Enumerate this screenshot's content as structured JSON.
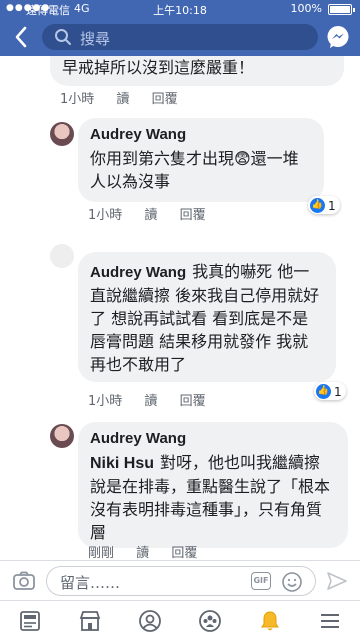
{
  "status_bar": {
    "carrier": "遠傳電信",
    "network": "4G",
    "time": "上午10:18",
    "battery_percent": "100%"
  },
  "nav": {
    "search_placeholder": "搜尋",
    "back_icon": "chevron-left-icon",
    "messenger_icon": "messenger-icon",
    "accent_color": "#4267b2"
  },
  "comments": [
    {
      "text": "早戒掉所以沒到這麼嚴重！",
      "time": "1小時",
      "read_label": "讀",
      "reply_label": "回覆"
    },
    {
      "author": "Audrey Wang",
      "text": "你用到第六隻才出現😨還一堆人以為沒事",
      "time": "1小時",
      "read_label": "讀",
      "reply_label": "回覆",
      "reactions": "1"
    },
    {
      "author": "Audrey Wang",
      "text": "我真的嚇死 他一直說繼續擦 後來我自己停用就好了 想說再試試看 看到底是不是唇膏問題 結果移用就發作 我就再也不敢用了",
      "time": "1小時",
      "read_label": "讀",
      "reply_label": "回覆",
      "reactions": "1"
    },
    {
      "author": "Audrey Wang",
      "mention": "Niki Hsu",
      "text": "對呀，他也叫我繼續擦說是在排毒，重點醫生說了「根本沒有表明排毒這種事」，只有角質層",
      "time": "剛剛",
      "read_label": "讀",
      "reply_label": "回覆"
    }
  ],
  "reply_bar": {
    "placeholder": "留言……",
    "gif_label": "GIF"
  },
  "tab_bar": {
    "items": [
      "news-feed-icon",
      "marketplace-icon",
      "profile-icon",
      "groups-icon",
      "notifications-icon",
      "menu-icon"
    ],
    "notification_color": "#f7b928"
  }
}
